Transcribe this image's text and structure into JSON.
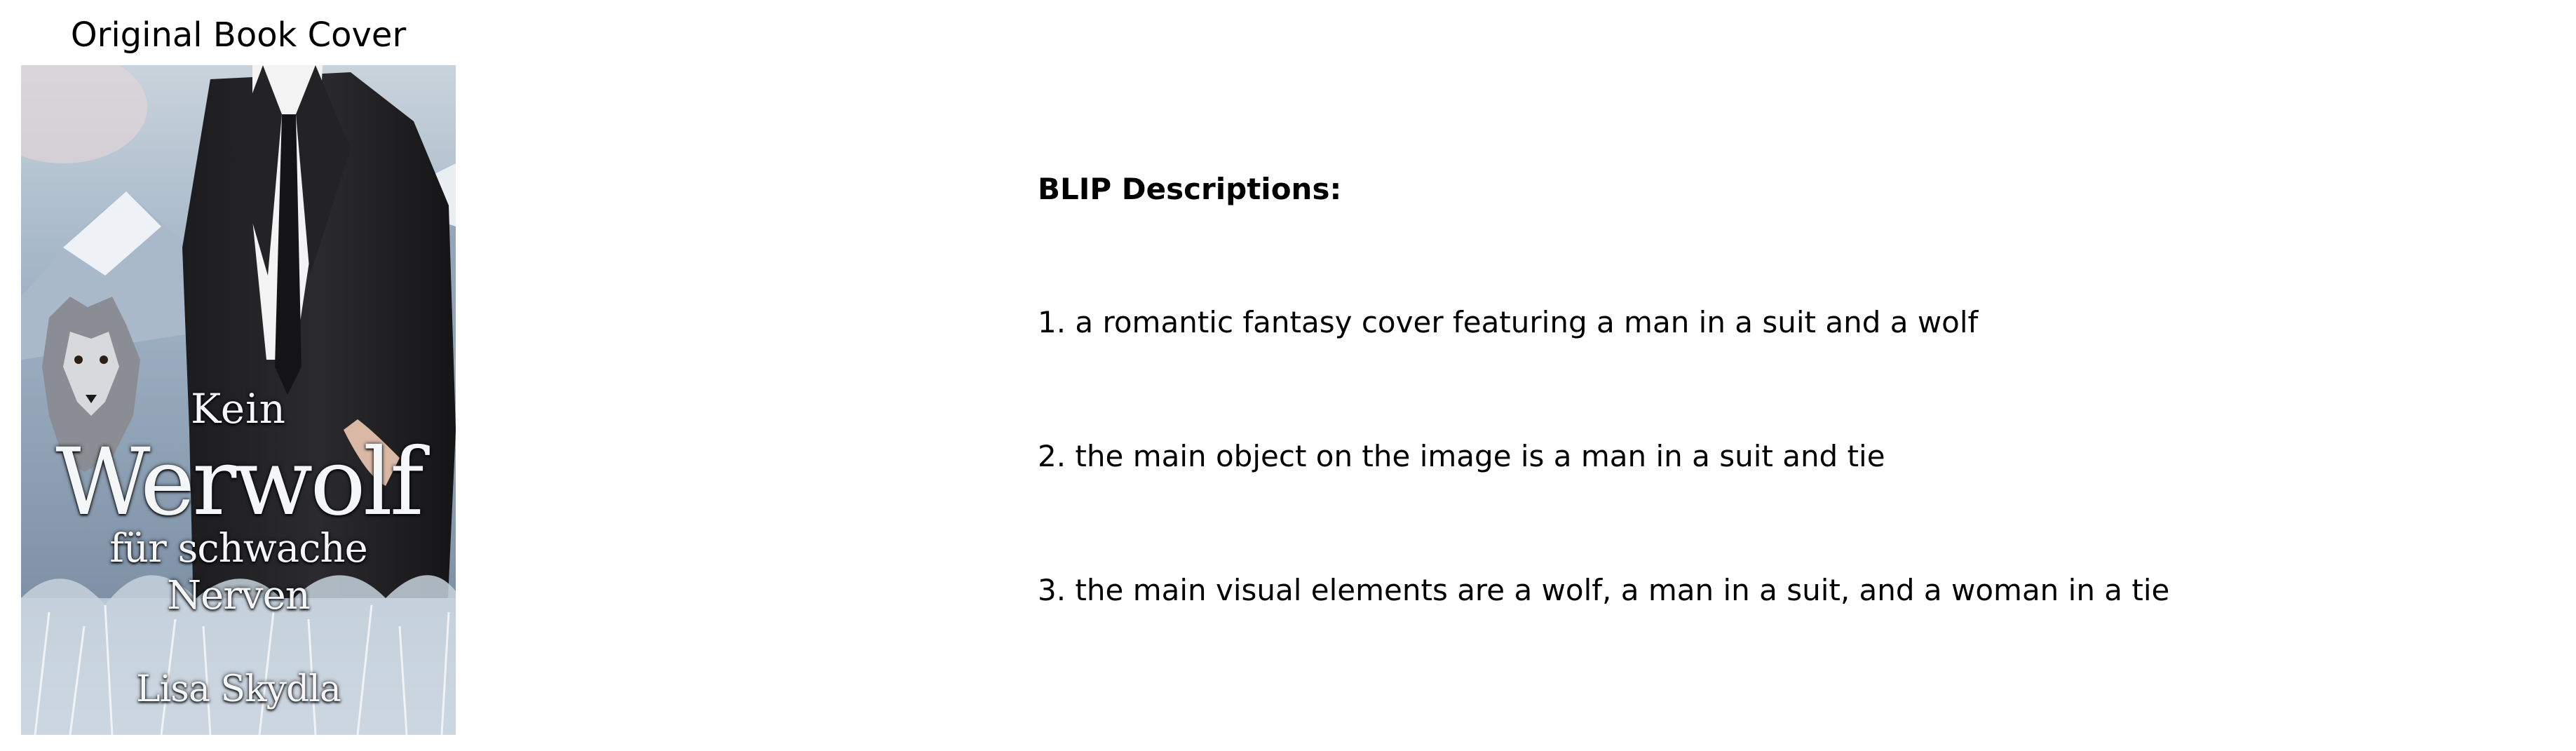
{
  "cover_panel": {
    "title": "Original Book Cover",
    "cover": {
      "line1": "Kein",
      "line2": "Werwolf",
      "line3": "für schwache",
      "line4": "Nerven",
      "author": "Lisa Skydla"
    }
  },
  "descriptions": {
    "heading": "BLIP Descriptions:",
    "items": [
      "1. a romantic fantasy cover featuring a man in a suit and a wolf",
      "2. the main object on the image is a man in a suit and tie",
      "3. the main visual elements are a wolf, a man in a suit, and a woman in a tie"
    ]
  },
  "colors": {
    "background": "#ffffff",
    "text": "#000000",
    "cover_text": "#f4f6f8"
  }
}
